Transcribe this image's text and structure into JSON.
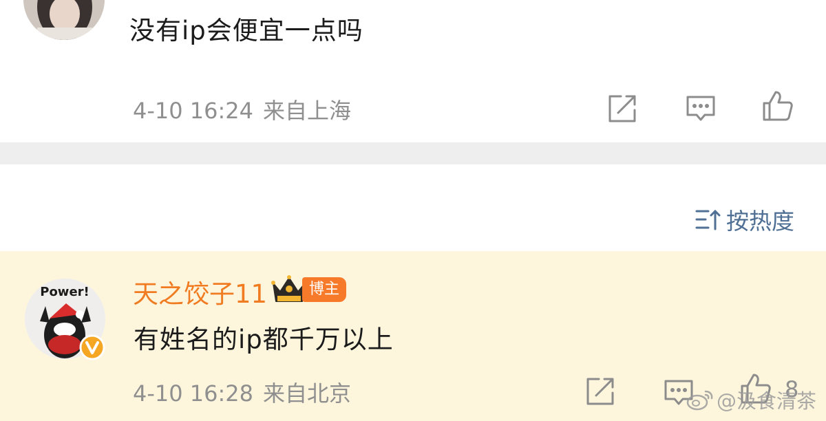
{
  "comments": [
    {
      "text": "没有ip会便宜一点吗",
      "timestamp": "4-10 16:24",
      "location": "来自上海"
    },
    {
      "username": "天之饺子11",
      "badge": "博主",
      "avatar_caption": "Power!",
      "text": "有姓名的ip都千万以上",
      "timestamp": "4-10 16:28",
      "location": "来自北京",
      "like_count": "8"
    }
  ],
  "sort": {
    "label": "按热度"
  },
  "watermark": {
    "text": "@汲食清茶"
  },
  "icons": {
    "share": "share-icon",
    "comment": "comment-icon",
    "like": "like-icon",
    "sort": "sort-icon",
    "crown": "crown-icon",
    "verified": "verified-v-icon",
    "weibo": "weibo-logo-icon"
  },
  "colors": {
    "username": "#f07b21",
    "badge": "#f77a2a",
    "sort": "#4f6f94",
    "highlight_bg": "#fdf6dd",
    "meta": "#8f8f8f"
  }
}
